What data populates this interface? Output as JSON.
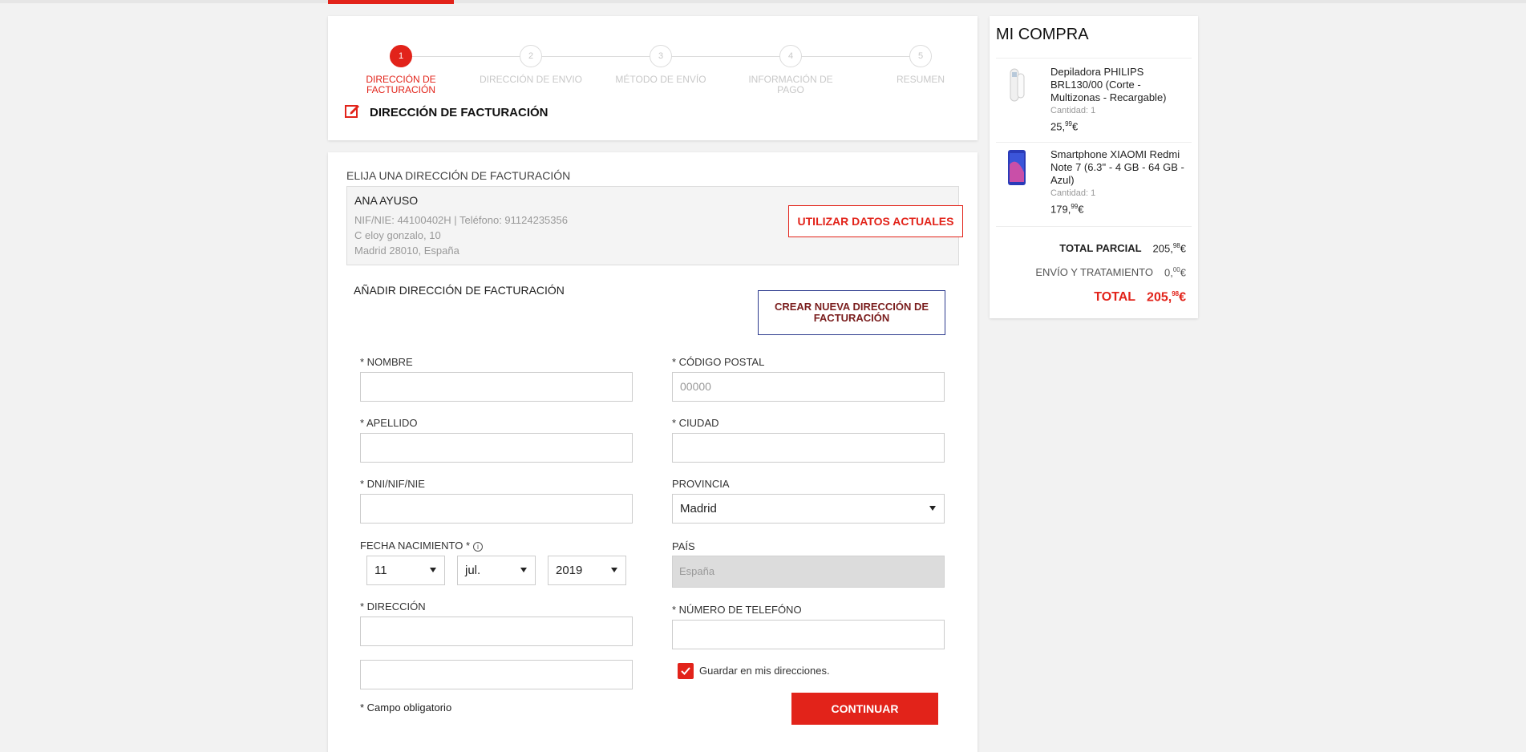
{
  "brand": {
    "accent": "#e2231a",
    "blue_border": "#2d3b8e"
  },
  "progress": {
    "current_step": 1,
    "total_steps": 5
  },
  "steps": [
    {
      "num": "1",
      "label": "DIRECCIÓN DE FACTURACIÓN",
      "active": true
    },
    {
      "num": "2",
      "label": "DIRECCIÓN DE ENVIO",
      "active": false
    },
    {
      "num": "3",
      "label": "MÉTODO DE ENVÍO",
      "active": false
    },
    {
      "num": "4",
      "label": "INFORMACIÓN DE PAGO",
      "active": false
    },
    {
      "num": "5",
      "label": "RESUMEN",
      "active": false
    }
  ],
  "section": {
    "icon": "edit-icon",
    "title": "DIRECCIÓN DE FACTURACIÓN"
  },
  "billing": {
    "choose_label": "ELIJA UNA DIRECCIÓN DE FACTURACIÓN",
    "saved": {
      "name": "ANA AYUSO",
      "ids": "NIF/NIE: 44100402H | Teléfono: 91124235356",
      "street": "C eloy gonzalo, 10",
      "city": "Madrid 28010, España"
    },
    "use_current_button": "UTILIZAR DATOS ACTUALES",
    "add_label": "AÑADIR DIRECCIÓN DE FACTURACIÓN",
    "create_button": "CREAR NUEVA DIRECCIÓN DE FACTURACIÓN"
  },
  "form": {
    "nombre_label": "* NOMBRE",
    "nombre_value": "",
    "apellido_label": "* APELLIDO",
    "apellido_value": "",
    "dni_label": "* DNI/NIF/NIE",
    "dni_value": "",
    "birth_label": "FECHA NACIMIENTO *",
    "birth_info_icon": "info-icon",
    "birth_day": "11",
    "birth_month": "jul.",
    "birth_year": "2019",
    "direccion_label": "* DIRECCIÓN",
    "direccion_value": "",
    "direccion2_value": "",
    "cp_label": "* CÓDIGO POSTAL",
    "cp_placeholder": "00000",
    "ciudad_label": "* CIUDAD",
    "ciudad_value": "",
    "provincia_label": "PROVINCIA",
    "provincia_value": "Madrid",
    "pais_label": "PAÍS",
    "pais_value": "España",
    "telefono_label": "* NÚMERO DE TELEFÓNO",
    "telefono_value": "",
    "save_checkbox_label": "Guardar en mis direcciones.",
    "save_checked": true,
    "required_note": "* Campo obligatorio",
    "continue_button": "CONTINUAR"
  },
  "summary": {
    "title": "MI COMPRA",
    "products": [
      {
        "name": "Depiladora PHILIPS BRL130/00 (Corte - Multizonas - Recargable)",
        "qty": "Cantidad: 1",
        "price_int": "25,",
        "price_dec": "99",
        "currency": "€",
        "thumb": "epilator-image"
      },
      {
        "name": "Smartphone XIAOMI Redmi Note 7 (6.3'' - 4 GB - 64 GB - Azul)",
        "qty": "Cantidad: 1",
        "price_int": "179,",
        "price_dec": "99",
        "currency": "€",
        "thumb": "smartphone-image"
      }
    ],
    "subtotal_label": "TOTAL PARCIAL",
    "subtotal_int": "205,",
    "subtotal_dec": "98",
    "shipping_label": "ENVÍO Y TRATAMIENTO",
    "shipping_int": "0,",
    "shipping_dec": "00",
    "total_label": "TOTAL",
    "total_int": "205,",
    "total_dec": "98",
    "currency": "€"
  }
}
